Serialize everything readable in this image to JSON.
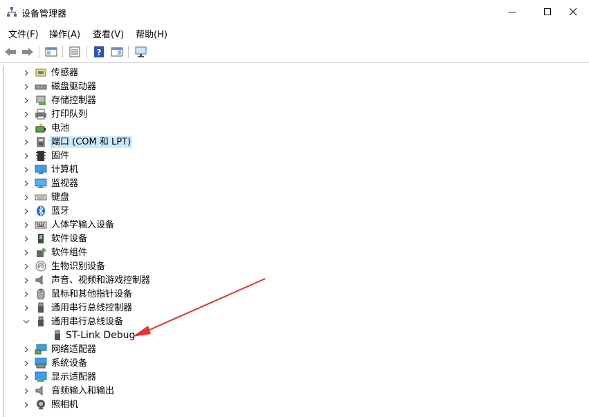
{
  "window": {
    "title": "设备管理器"
  },
  "menu": [
    {
      "label": "文件(F)"
    },
    {
      "label": "操作(A)"
    },
    {
      "label": "查看(V)"
    },
    {
      "label": "帮助(H)"
    }
  ],
  "tree": {
    "items": [
      {
        "label": "传感器",
        "icon": "sensor-icon",
        "expanded": false
      },
      {
        "label": "磁盘驱动器",
        "icon": "disk-drive-icon",
        "expanded": false
      },
      {
        "label": "存储控制器",
        "icon": "storage-controller-icon",
        "expanded": false
      },
      {
        "label": "打印队列",
        "icon": "printer-icon",
        "expanded": false
      },
      {
        "label": "电池",
        "icon": "battery-icon",
        "expanded": false
      },
      {
        "label": "端口 (COM 和 LPT)",
        "icon": "port-icon",
        "expanded": false,
        "selected": true
      },
      {
        "label": "固件",
        "icon": "firmware-icon",
        "expanded": false
      },
      {
        "label": "计算机",
        "icon": "computer-icon",
        "expanded": false
      },
      {
        "label": "监视器",
        "icon": "monitor-icon",
        "expanded": false
      },
      {
        "label": "键盘",
        "icon": "keyboard-icon",
        "expanded": false
      },
      {
        "label": "蓝牙",
        "icon": "bluetooth-icon",
        "expanded": false
      },
      {
        "label": "人体学输入设备",
        "icon": "hid-icon",
        "expanded": false
      },
      {
        "label": "软件设备",
        "icon": "software-device-icon",
        "expanded": false
      },
      {
        "label": "软件组件",
        "icon": "software-component-icon",
        "expanded": false
      },
      {
        "label": "生物识别设备",
        "icon": "fingerprint-icon",
        "expanded": false
      },
      {
        "label": "声音、视频和游戏控制器",
        "icon": "speaker-icon",
        "expanded": false
      },
      {
        "label": "鼠标和其他指针设备",
        "icon": "mouse-icon",
        "expanded": false
      },
      {
        "label": "通用串行总线控制器",
        "icon": "usb-icon",
        "expanded": false
      },
      {
        "label": "通用串行总线设备",
        "icon": "usb-icon",
        "expanded": true,
        "children": [
          {
            "label": "ST-Link Debug",
            "icon": "usb-icon"
          }
        ]
      },
      {
        "label": "网络适配器",
        "icon": "network-adapter-icon",
        "expanded": false
      },
      {
        "label": "系统设备",
        "icon": "system-device-icon",
        "expanded": false
      },
      {
        "label": "显示适配器",
        "icon": "display-adapter-icon",
        "expanded": false
      },
      {
        "label": "音频输入和输出",
        "icon": "audio-io-icon",
        "expanded": false
      },
      {
        "label": "照相机",
        "icon": "camera-icon",
        "expanded": false
      }
    ]
  },
  "annotation": {
    "color": "#e8352c",
    "points_to": "ST-Link Debug"
  }
}
